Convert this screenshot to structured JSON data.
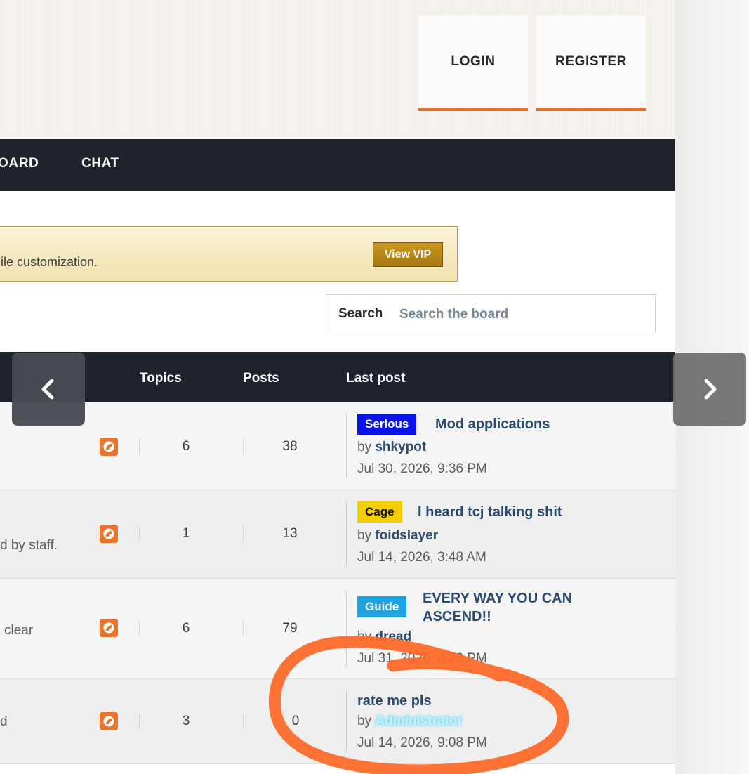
{
  "header": {
    "login_label": "LOGIN",
    "register_label": "REGISTER"
  },
  "nav": {
    "items": [
      "OARD",
      "CHAT"
    ]
  },
  "vip_banner": {
    "text": "ile customization.",
    "button_label": "View VIP"
  },
  "search": {
    "label": "Search",
    "placeholder": "Search the board"
  },
  "table": {
    "headers": {
      "topics": "Topics",
      "posts": "Posts",
      "last_post": "Last post"
    },
    "rows": [
      {
        "description": "",
        "topics": "6",
        "posts": "38",
        "tag": "Serious",
        "title": "Mod applications",
        "by_prefix": "by",
        "author": "shkypot",
        "date": "Jul 30, 2026, 9:36 PM"
      },
      {
        "description": "d by staff.",
        "topics": "1",
        "posts": "13",
        "tag": "Cage",
        "title": "I heard tcj talking shit",
        "by_prefix": "by",
        "author": "foidslayer",
        "date": "Jul 14, 2026, 3:48 AM"
      },
      {
        "description": "clear",
        "topics": "6",
        "posts": "79",
        "tag": "Guide",
        "title_line1": "EVERY WAY YOU CAN",
        "title_line2": "ASCEND!!",
        "by_prefix": "by",
        "author": "dread",
        "date": "Jul 31, 2026, 4:20 PM"
      },
      {
        "description": "d",
        "topics": "3",
        "posts": "0",
        "title": "rate me pls",
        "by_prefix": "by",
        "author": "Administrator",
        "date": "Jul 14, 2026, 9:08 PM"
      }
    ]
  },
  "colors": {
    "accent": "#e2702c",
    "nav_bg": "#1f232b",
    "link": "#2b4a6e",
    "annotation": "#ff6a2b"
  },
  "icons": {
    "rss": "rss-icon",
    "prev": "chevron-left-icon",
    "next": "chevron-right-icon"
  }
}
